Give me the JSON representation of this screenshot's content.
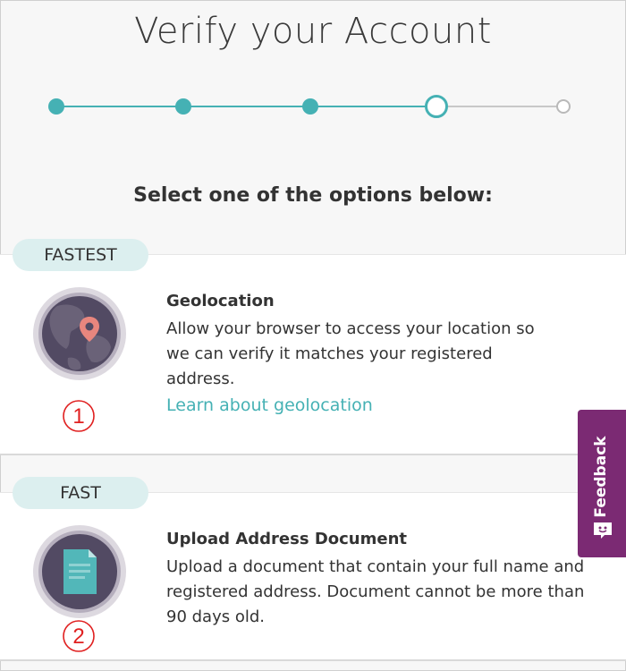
{
  "page": {
    "title": "Verify your Account",
    "subtitle": "Select one of the options below:"
  },
  "stepper": {
    "total_steps": 5,
    "current_step": 4,
    "completed_steps": 3,
    "accent_color": "#45b1b4"
  },
  "options": [
    {
      "badge": "FASTEST",
      "title": "Geolocation",
      "description": "Allow your browser to access your location so we can verify it matches your registered address.",
      "link": "Learn about geolocation",
      "icon": "globe-location-pin-icon",
      "annotation": "1"
    },
    {
      "badge": "FAST",
      "title": "Upload Address Document",
      "description": "Upload a document that contain your full name and registered address. Document cannot be more than 90 days old.",
      "icon": "document-icon",
      "annotation": "2"
    }
  ],
  "feedback": {
    "label": "Feedback",
    "color": "#7b2a73",
    "icon": "feedback-face-icon"
  }
}
